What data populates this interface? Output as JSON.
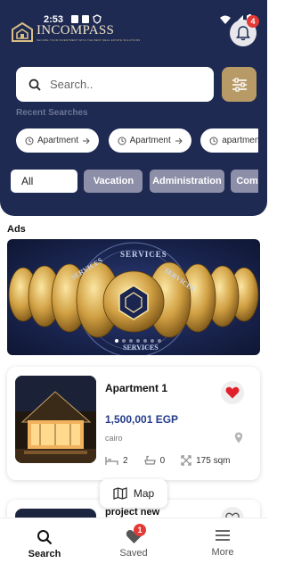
{
  "status_bar": {
    "time": "2:53"
  },
  "brand": {
    "name": "INCOMPASS",
    "tagline": "SECURE YOUR INVESTMENT WITH THE BEST REAL ESTATE SOLUTIONS"
  },
  "notifications": {
    "count": "4",
    "icon": "bell-icon"
  },
  "search": {
    "placeholder": "Search..",
    "value": ""
  },
  "recent": {
    "label": "Recent Searches",
    "items": [
      {
        "label": "Apartment"
      },
      {
        "label": "Apartment"
      },
      {
        "label": "apartmen"
      }
    ]
  },
  "categories": {
    "items": [
      {
        "label": "All",
        "active": true
      },
      {
        "label": "Vacation"
      },
      {
        "label": "Administration"
      },
      {
        "label": "Comme"
      }
    ]
  },
  "ads": {
    "title": "Ads",
    "banner_text": "SERVICES",
    "slide_count": 7,
    "active_slide": 0
  },
  "listings": [
    {
      "title": "Apartment 1",
      "price": "1,500,001 EGP",
      "location": "cairo",
      "beds": "2",
      "baths": "0",
      "area": "175 sqm",
      "favorite": true
    },
    {
      "title": "project new",
      "favorite": false
    }
  ],
  "map_button": {
    "label": "Map"
  },
  "bottom_nav": {
    "search": "Search",
    "saved": "Saved",
    "saved_badge": "1",
    "more": "More"
  },
  "colors": {
    "header": "#1e2a52",
    "accent_gold": "#b89a66",
    "price_blue": "#243b8a",
    "badge_red": "#e53935"
  }
}
